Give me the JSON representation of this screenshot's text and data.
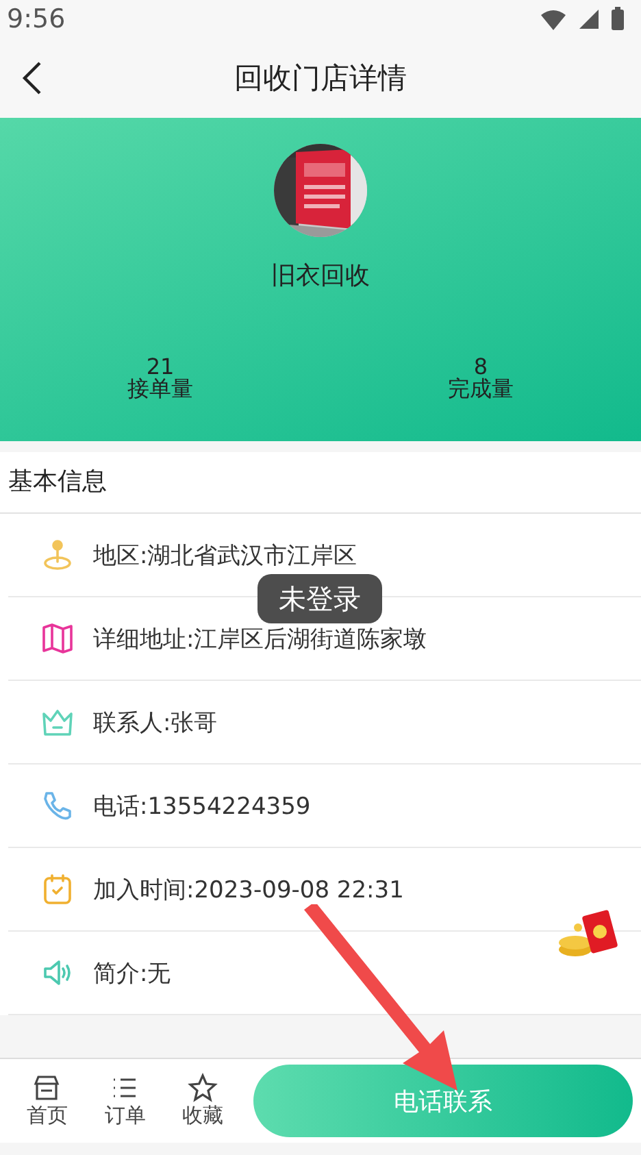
{
  "status_bar": {
    "time": "9:56"
  },
  "nav": {
    "title": "回收门店详情"
  },
  "store": {
    "name": "旧衣回收",
    "stats": [
      {
        "value": "21",
        "label": "接单量"
      },
      {
        "value": "8",
        "label": "完成量"
      }
    ]
  },
  "section": {
    "title": "基本信息"
  },
  "info_rows": [
    {
      "kind": "pin",
      "color": "#f2c45a",
      "text": "地区:湖北省武汉市江岸区"
    },
    {
      "kind": "map",
      "color": "#e8359a",
      "text": "详细地址:江岸区后湖街道陈家墩"
    },
    {
      "kind": "crown",
      "color": "#5fd3b8",
      "text": "联系人:张哥"
    },
    {
      "kind": "phone",
      "color": "#6ab4e8",
      "text": "电话:13554224359"
    },
    {
      "kind": "calendar",
      "color": "#f0b030",
      "text": "加入时间:2023-09-08 22:31"
    },
    {
      "kind": "speaker",
      "color": "#4cc9b0",
      "text": "简介:无"
    }
  ],
  "toast": {
    "text": "未登录"
  },
  "bottom_bar": {
    "tabs": [
      {
        "kind": "store",
        "label": "首页"
      },
      {
        "kind": "list",
        "label": "订单"
      },
      {
        "kind": "star",
        "label": "收藏"
      }
    ],
    "call_button": "电话联系"
  }
}
